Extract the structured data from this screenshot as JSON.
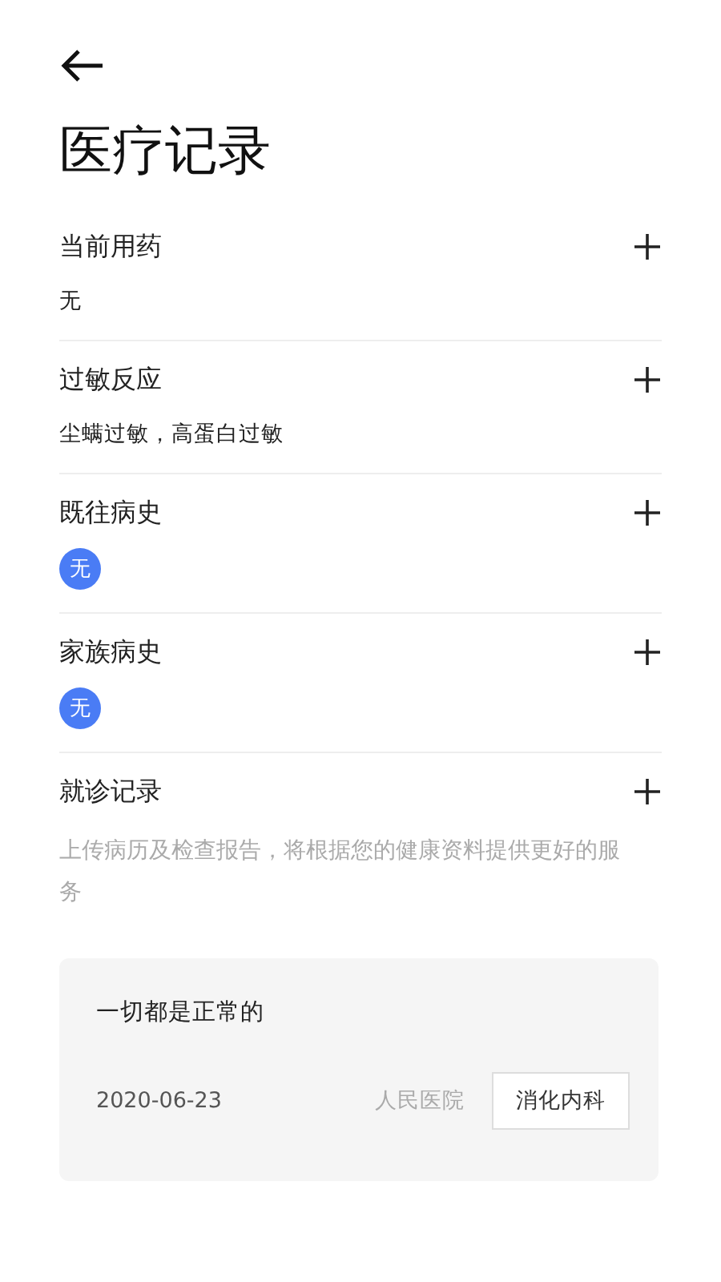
{
  "title": "医疗记录",
  "sections": [
    {
      "label": "当前用药",
      "kind": "text",
      "value": "无"
    },
    {
      "label": "过敏反应",
      "kind": "text",
      "value": "尘螨过敏，高蛋白过敏"
    },
    {
      "label": "既往病史",
      "kind": "badge",
      "value": "无"
    },
    {
      "label": "家族病史",
      "kind": "badge",
      "value": "无"
    },
    {
      "label": "就诊记录",
      "kind": "hint",
      "value": "上传病历及检查报告，将根据您的健康资料提供更好的服务"
    }
  ],
  "record": {
    "title": "一切都是正常的",
    "date": "2020-06-23",
    "hospital": "人民医院",
    "department": "消化内科"
  }
}
